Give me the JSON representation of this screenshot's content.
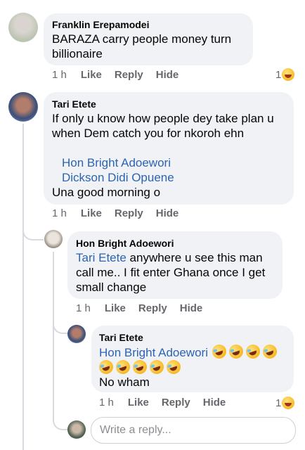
{
  "comments": [
    {
      "author": "Franklin Erepamodei",
      "lines": [
        "BARAZA  carry people money turn",
        "billionaire"
      ],
      "time": "1 h",
      "like": "Like",
      "reply": "Reply",
      "hide": "Hide",
      "reactions": "1"
    },
    {
      "author": "Tari Etete",
      "lines": [
        "If only u know how people dey take plan u",
        "when Dem catch you for nkoroh ehn"
      ],
      "mentions": [
        "Hon Bright Adoewori",
        "Dickson Didi Opuene"
      ],
      "tail": "Una good morning o",
      "time": "1 h",
      "like": "Like",
      "reply": "Reply",
      "hide": "Hide"
    },
    {
      "author": "Hon Bright Adoewori",
      "mention": "Tari Etete",
      "line1_rest": " anywhere u see this man",
      "lines": [
        "call me.. I fit enter Ghana once I get",
        "small change"
      ],
      "time": "1 h",
      "like": "Like",
      "reply": "Reply",
      "hide": "Hide"
    },
    {
      "author": "Tari Etete",
      "mention": "Hon Bright Adoewori",
      "emoji_name": "rolling-on-floor-laughing",
      "tail": "No wham",
      "time": "1 h",
      "like": "Like",
      "reply": "Reply",
      "hide": "Hide",
      "reactions": "1"
    }
  ],
  "reply_box": {
    "placeholder": "Write a reply..."
  },
  "colors": {
    "bubble": "#f0f2f5",
    "mention": "#2c64b4",
    "meta": "#65676b"
  }
}
